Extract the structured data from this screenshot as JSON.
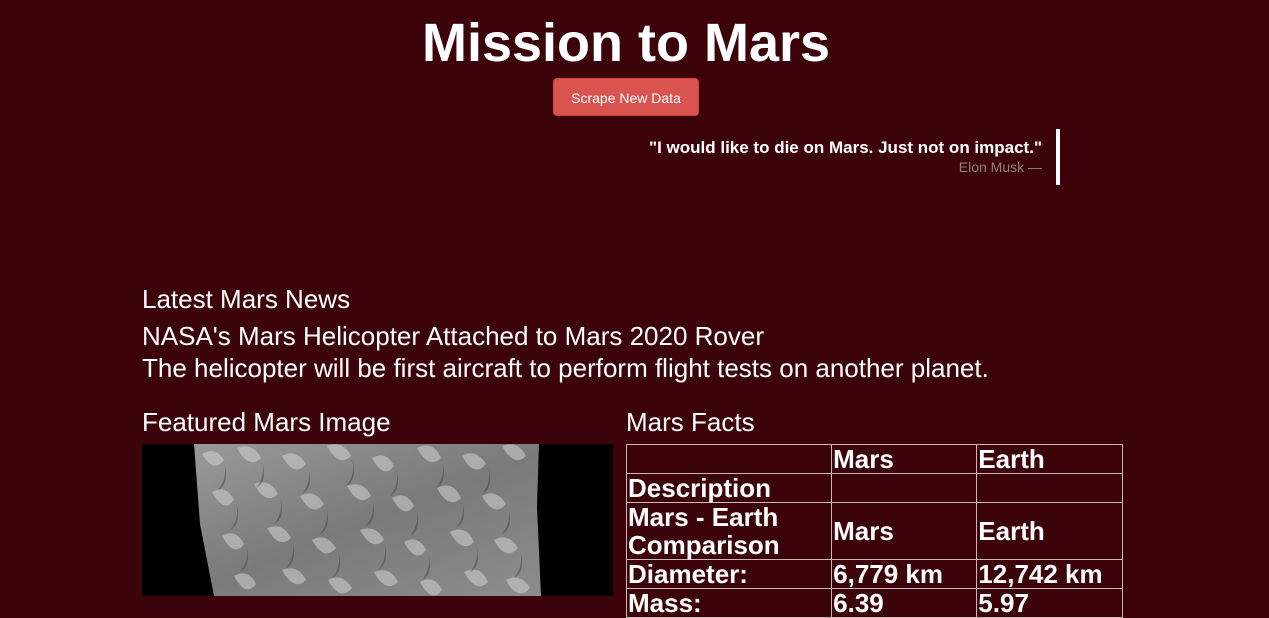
{
  "header": {
    "title": "Mission to Mars",
    "scrape_button_label": "Scrape New Data"
  },
  "quote": {
    "text": "\"I would like to die on Mars. Just not on impact.\"",
    "author": "Elon Musk —"
  },
  "news": {
    "heading": "Latest Mars News",
    "title": "NASA's Mars Helicopter Attached to Mars 2020 Rover",
    "teaser": "The helicopter will be first aircraft to perform flight tests on another planet."
  },
  "featured_image": {
    "heading": "Featured Mars Image"
  },
  "facts": {
    "heading": "Mars Facts",
    "columns": [
      "",
      "Mars",
      "Earth"
    ],
    "rows": [
      {
        "label": "Description",
        "mars": "",
        "earth": ""
      },
      {
        "label": "Mars - Earth Comparison",
        "mars": "Mars",
        "earth": "Earth"
      },
      {
        "label": "Diameter:",
        "mars": "6,779 km",
        "earth": "12,742 km"
      },
      {
        "label": "Mass:",
        "mars": "6.39",
        "earth": "5.97"
      }
    ]
  }
}
